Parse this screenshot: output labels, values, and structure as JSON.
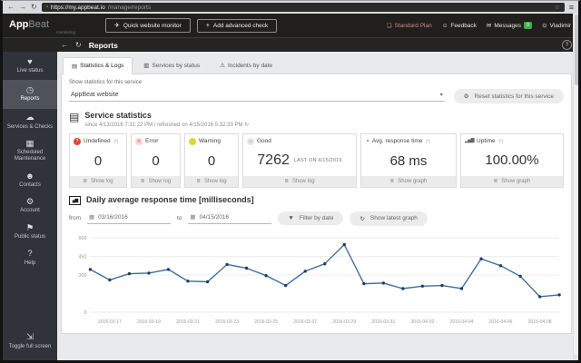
{
  "browser": {
    "url_main": "https://my.appbeat.io",
    "url_path": "/manage/reports"
  },
  "icons": {
    "back": "←",
    "forward": "→",
    "reload": "↻",
    "lock": "▪",
    "star": "☆",
    "menu": "≡",
    "send": "✈",
    "plus": "+",
    "external": "❏",
    "smiley": "☺",
    "envelope": "✉",
    "power": "⊙",
    "help": "?",
    "refresh": "↻",
    "gear": "⚙",
    "caret": "▾",
    "calendar": "▦",
    "funnel": "▼",
    "doc": "▤",
    "show": "≣",
    "area": "▄▆",
    "gauge": "◔",
    "bars": "▂▅▇"
  },
  "header": {
    "logo_app": "App",
    "logo_beat": "Beat",
    "logo_sub": ".monitoring",
    "quick_monitor_label": "Quick website monitor",
    "add_check_label": "Add advanced check",
    "plan_label": "Standard Plan",
    "feedback_label": "Feedback",
    "messages_label": "Messages",
    "messages_badge": "0",
    "user_label": "Vladimir"
  },
  "subheader": {
    "title": "Reports",
    "help": "?"
  },
  "sidebar": {
    "items": [
      {
        "label": "Live status",
        "icon": "♥"
      },
      {
        "label": "Reports",
        "icon": "◷",
        "active": true
      },
      {
        "label": "Services & Checks",
        "icon": "☁"
      },
      {
        "label": "Scheduled Maintenance",
        "icon": "▦"
      },
      {
        "label": "Contacts",
        "icon": "☻"
      },
      {
        "label": "Account",
        "icon": "⚙"
      },
      {
        "label": "Public status",
        "icon": "⚑"
      },
      {
        "label": "Help",
        "icon": "?"
      },
      {
        "label": "Toggle full screen",
        "icon": "⇲"
      }
    ]
  },
  "main": {
    "tabs": [
      {
        "label": "Statistics & Logs",
        "icon": "▤",
        "active": true
      },
      {
        "label": "Services by status",
        "icon": "▥"
      },
      {
        "label": "Incidents by date",
        "icon": "⚠"
      }
    ],
    "service_select": {
      "label": "Show statistics for this service",
      "value": "AppBeat website"
    },
    "reset_button": "Reset statistics for this service",
    "stats": {
      "title": "Service statistics",
      "subtitle": "since 4/13/2016 7:31:22 PM / refreshed on 4/15/2016 5:32:33 PM",
      "cards": [
        {
          "label": "Undefined",
          "sup": "[*]",
          "glyph": "?",
          "value": "0",
          "action": "Show log"
        },
        {
          "label": "Error",
          "glyph": "✕",
          "value": "0",
          "action": "Show log"
        },
        {
          "label": "Warning",
          "glyph": "●",
          "value": "0",
          "action": "Show log"
        },
        {
          "label": "Good",
          "glyph": "☺",
          "value": "7262",
          "note": "LAST ON 4/15/2016",
          "action": "Show log"
        },
        {
          "label": "Avg. response time",
          "sup": "[*]",
          "value": "68 ms",
          "action": "Show graph"
        },
        {
          "label": "Uptime",
          "sup": "[*]",
          "value": "100.00%",
          "action": "Show graph"
        }
      ]
    },
    "graph": {
      "title": "Daily average response time [milliseconds]",
      "from_label": "from",
      "from_value": "03/16/2016",
      "to_label": "to",
      "to_value": "04/15/2016",
      "filter_button": "Filter by date",
      "latest_button": "Show latest graph"
    }
  },
  "chart_data": {
    "type": "line",
    "title": "Daily average response time [milliseconds]",
    "x": [
      "2016-03-16",
      "2016-03-17",
      "2016-03-18",
      "2016-03-19",
      "2016-03-20",
      "2016-03-21",
      "2016-03-22",
      "2016-03-23",
      "2016-03-24",
      "2016-03-25",
      "2016-03-26",
      "2016-03-27",
      "2016-03-28",
      "2016-03-29",
      "2016-03-30",
      "2016-03-31",
      "2016-04-01",
      "2016-04-02",
      "2016-04-03",
      "2016-04-04",
      "2016-04-05",
      "2016-04-06",
      "2016-04-07",
      "2016-04-08",
      "2016-04-09"
    ],
    "values": [
      345,
      260,
      310,
      315,
      345,
      250,
      245,
      385,
      355,
      295,
      215,
      330,
      390,
      545,
      230,
      235,
      190,
      210,
      215,
      190,
      430,
      375,
      290,
      125,
      140
    ],
    "x_tick_labels": [
      "2016-03-17",
      "2016-03-19",
      "2016-03-21",
      "2016-03-23",
      "2016-03-25",
      "2016-03-27",
      "2016-03-29",
      "2016-03-31",
      "2016-04-02",
      "2016-04-04",
      "2016-04-06",
      "2016-04-08"
    ],
    "y_ticks": [
      0,
      300,
      450,
      600
    ],
    "ylim": [
      0,
      600
    ],
    "grid": true,
    "legend": "none",
    "line_color": "#3b6ea5",
    "point_color": "#1d3c63"
  }
}
